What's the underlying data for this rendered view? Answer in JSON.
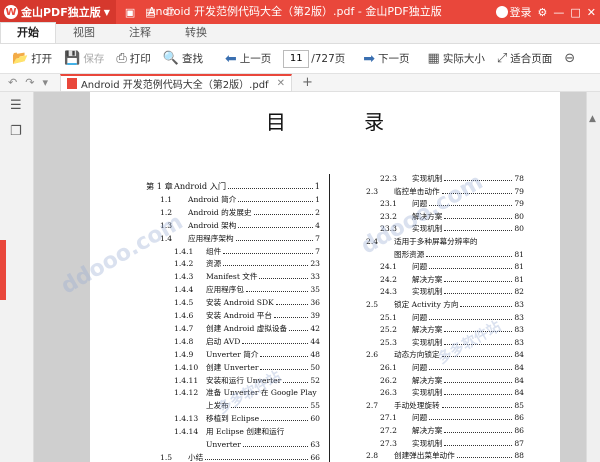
{
  "app": {
    "brand": "金山PDF独立版",
    "window_title": "Android 开发范例代码大全（第2版）.pdf - 金山PDF独立版",
    "login": "登录",
    "window_controls": [
      "⚙",
      "—",
      "□",
      "✕"
    ]
  },
  "menu": {
    "tabs": [
      {
        "label": "开始",
        "active": true
      },
      {
        "label": "视图",
        "active": false
      },
      {
        "label": "注释",
        "active": false
      },
      {
        "label": "转换",
        "active": false
      }
    ]
  },
  "toolbar": {
    "open": "打开",
    "save": "保存",
    "print": "打印",
    "find": "查找",
    "prev_page": "上一页",
    "page_current": "11",
    "page_total": "/727页",
    "next_page": "下一页",
    "actual_size": "实际大小",
    "fit_page": "适合页面"
  },
  "tabstrip": {
    "doc_tab": "Android 开发范例代码大全（第2版）.pdf",
    "close": "✕",
    "new_tab": "+"
  },
  "document": {
    "toc_title": "目 录",
    "left_column": [
      {
        "num": "第 1 章",
        "text": "Android 入门",
        "page": "1",
        "level": 1
      },
      {
        "num": "1.1",
        "text": "Android 简介",
        "page": "1",
        "level": 2
      },
      {
        "num": "1.2",
        "text": "Android 的发展史",
        "page": "2",
        "level": 2
      },
      {
        "num": "1.3",
        "text": "Android 架构",
        "page": "4",
        "level": 2
      },
      {
        "num": "1.4",
        "text": "应用程序架构",
        "page": "7",
        "level": 2
      },
      {
        "num": "1.4.1",
        "text": "组件",
        "page": "7",
        "level": 3
      },
      {
        "num": "1.4.2",
        "text": "资源",
        "page": "23",
        "level": 3
      },
      {
        "num": "1.4.3",
        "text": "Manifest 文件",
        "page": "33",
        "level": 3
      },
      {
        "num": "1.4.4",
        "text": "应用程序包",
        "page": "35",
        "level": 3
      },
      {
        "num": "1.4.5",
        "text": "安装 Android SDK",
        "page": "36",
        "level": 3
      },
      {
        "num": "1.4.6",
        "text": "安装 Android 平台",
        "page": "39",
        "level": 3
      },
      {
        "num": "1.4.7",
        "text": "创建 Android 虚拟设备",
        "page": "42",
        "level": 3
      },
      {
        "num": "1.4.8",
        "text": "启动 AVD",
        "page": "44",
        "level": 3
      },
      {
        "num": "1.4.9",
        "text": "Unverter 简介",
        "page": "48",
        "level": 3
      },
      {
        "num": "1.4.10",
        "text": "创建 Unverter",
        "page": "50",
        "level": 3
      },
      {
        "num": "1.4.11",
        "text": "安装和运行 Unverter",
        "page": "52",
        "level": 3
      },
      {
        "num": "1.4.12",
        "text": "准备 Unverter 在 Google Play",
        "page": "",
        "level": 3
      },
      {
        "num": "",
        "text": "上发布",
        "page": "55",
        "level": 3
      },
      {
        "num": "1.4.13",
        "text": "移植到 Eclipse",
        "page": "60",
        "level": 3
      },
      {
        "num": "1.4.14",
        "text": "用 Eclipse 创建和运行",
        "page": "",
        "level": 3
      },
      {
        "num": "",
        "text": "Unverter",
        "page": "63",
        "level": 3
      },
      {
        "num": "1.5",
        "text": "小结",
        "page": "66",
        "level": 2
      }
    ],
    "right_column": [
      {
        "num": "22.3",
        "text": "实现机制",
        "page": "78",
        "level": 3
      },
      {
        "num": "2.3",
        "text": "临控单击动作",
        "page": "79",
        "level": 2
      },
      {
        "num": "23.1",
        "text": "问题",
        "page": "79",
        "level": 3
      },
      {
        "num": "23.2",
        "text": "解决方案",
        "page": "80",
        "level": 3
      },
      {
        "num": "23.3",
        "text": "实现机制",
        "page": "80",
        "level": 3
      },
      {
        "num": "2.4",
        "text": "适用于多种屏幕分辨率的",
        "page": "",
        "level": 2
      },
      {
        "num": "",
        "text": "图形资源",
        "page": "81",
        "level": 2
      },
      {
        "num": "24.1",
        "text": "问题",
        "page": "81",
        "level": 3
      },
      {
        "num": "24.2",
        "text": "解决方案",
        "page": "81",
        "level": 3
      },
      {
        "num": "24.3",
        "text": "实现机制",
        "page": "82",
        "level": 3
      },
      {
        "num": "2.5",
        "text": "锁定 Activity 方向",
        "page": "83",
        "level": 2
      },
      {
        "num": "25.1",
        "text": "问题",
        "page": "83",
        "level": 3
      },
      {
        "num": "25.2",
        "text": "解决方案",
        "page": "83",
        "level": 3
      },
      {
        "num": "25.3",
        "text": "实现机制",
        "page": "83",
        "level": 3
      },
      {
        "num": "2.6",
        "text": "动态方向锁定",
        "page": "84",
        "level": 2
      },
      {
        "num": "26.1",
        "text": "问题",
        "page": "84",
        "level": 3
      },
      {
        "num": "26.2",
        "text": "解决方案",
        "page": "84",
        "level": 3
      },
      {
        "num": "26.3",
        "text": "实现机制",
        "page": "84",
        "level": 3
      },
      {
        "num": "2.7",
        "text": "手动处理旋转",
        "page": "85",
        "level": 2
      },
      {
        "num": "27.1",
        "text": "问题",
        "page": "86",
        "level": 3
      },
      {
        "num": "27.2",
        "text": "解决方案",
        "page": "86",
        "level": 3
      },
      {
        "num": "27.3",
        "text": "实现机制",
        "page": "87",
        "level": 3
      },
      {
        "num": "2.8",
        "text": "创建弹出菜单动作",
        "page": "88",
        "level": 2
      }
    ]
  },
  "watermark": "ddooo.com",
  "watermark_cn": "多多软件站"
}
